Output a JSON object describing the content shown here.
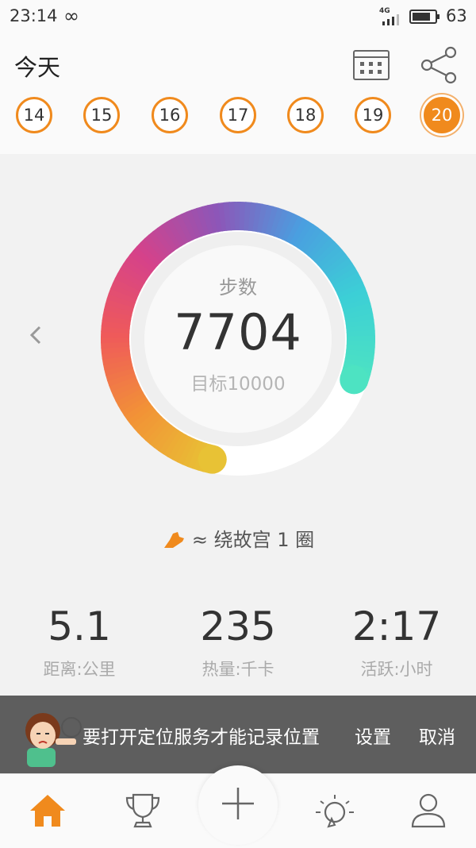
{
  "status_bar": {
    "time": "23:14",
    "loop_symbol": "∞",
    "network": "4G",
    "battery": "63"
  },
  "header": {
    "title": "今天",
    "calendar_icon": "calendar-icon",
    "share_icon": "share-icon"
  },
  "days": [
    {
      "label": "14",
      "active": false
    },
    {
      "label": "15",
      "active": false
    },
    {
      "label": "16",
      "active": false
    },
    {
      "label": "17",
      "active": false
    },
    {
      "label": "18",
      "active": false
    },
    {
      "label": "19",
      "active": false
    },
    {
      "label": "20",
      "active": true
    }
  ],
  "steps": {
    "label": "步数",
    "value": "7704",
    "goal": "目标10000",
    "progress": 0.7704,
    "gradient_colors": [
      "#e8c235",
      "#f29336",
      "#ef5a5a",
      "#d5428a",
      "#8d56b8",
      "#4a9fe0",
      "#3ccfd6",
      "#4de3c2"
    ]
  },
  "walk_hint": {
    "icon": "shoe-icon",
    "text": "≈ 绕故宫 1 圈"
  },
  "stats": [
    {
      "value": "5.1",
      "label": "距离:公里"
    },
    {
      "value": "235",
      "label": "热量:千卡"
    },
    {
      "value": "2:17",
      "label": "活跃:小时"
    }
  ],
  "toast": {
    "message": "要打开定位服务才能记录位置",
    "settings_label": "设置",
    "cancel_label": "取消"
  },
  "nav": {
    "items": [
      "home-icon",
      "trophy-icon",
      "add-icon",
      "lightbulb-icon",
      "profile-icon"
    ],
    "accent": "#f08a1d"
  }
}
